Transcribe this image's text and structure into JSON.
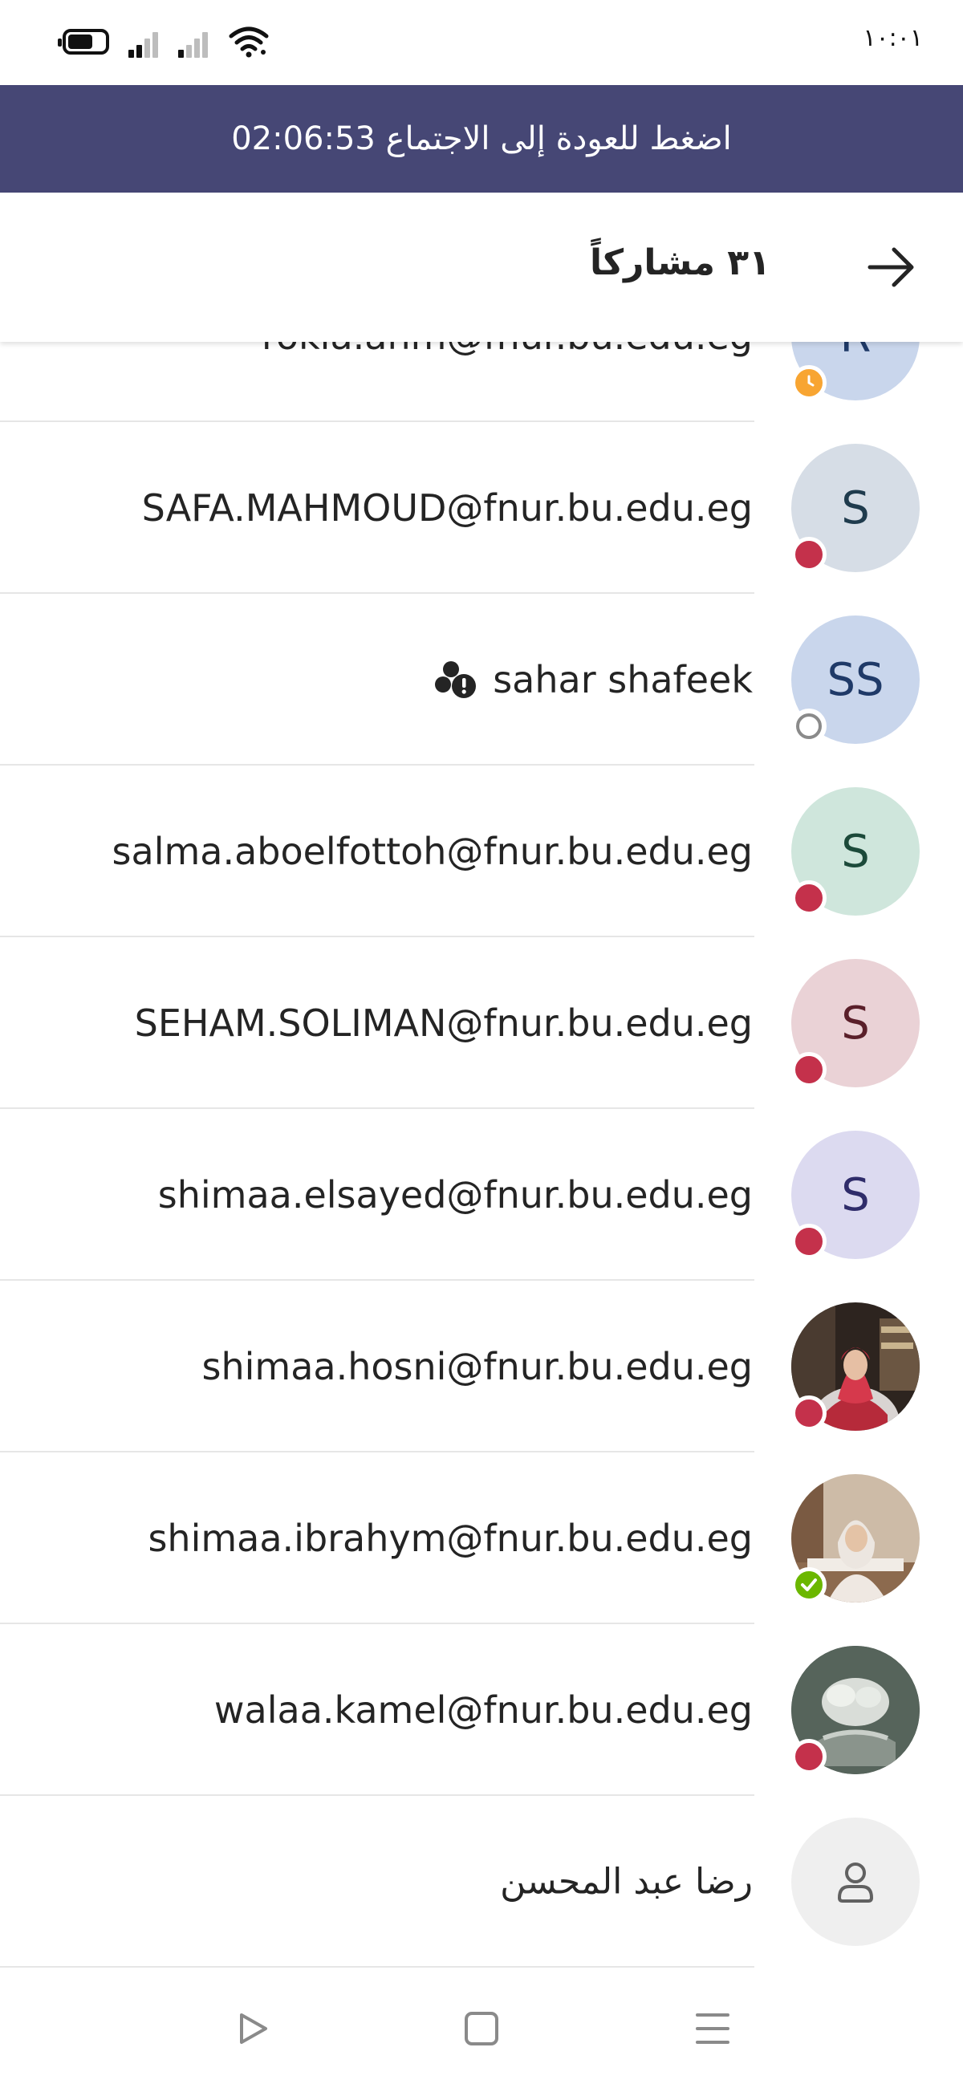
{
  "status_bar": {
    "time": "١٠:٠١"
  },
  "banner": {
    "text": "اضغط للعودة إلى الاجتماع 02:06:53"
  },
  "header": {
    "title": "٣١ مشاركاً"
  },
  "participants": [
    {
      "name": "rokia.ahm@fnur.bu.edu.eg",
      "initials": "R",
      "avatar_bg": "#c9d6ec",
      "avatar_fg": "#1f3a68",
      "presence": "away"
    },
    {
      "name": "SAFA.MAHMOUD@fnur.bu.edu.eg",
      "initials": "S",
      "avatar_bg": "#d6dde6",
      "avatar_fg": "#1f3b4d",
      "presence": "busy"
    },
    {
      "name": "sahar shafeek",
      "initials": "SS",
      "avatar_bg": "#c9d6ec",
      "avatar_fg": "#1f3a68",
      "presence": "offline",
      "tag_icon": "external-user-warning-icon"
    },
    {
      "name": "salma.aboelfottoh@fnur.bu.edu.eg",
      "initials": "S",
      "avatar_bg": "#cfe6dc",
      "avatar_fg": "#1c4a3a",
      "presence": "busy"
    },
    {
      "name": "SEHAM.SOLIMAN@fnur.bu.edu.eg",
      "initials": "S",
      "avatar_bg": "#ead2d6",
      "avatar_fg": "#5a1f2a",
      "presence": "busy"
    },
    {
      "name": "shimaa.elsayed@fnur.bu.edu.eg",
      "initials": "S",
      "avatar_bg": "#dcdaf0",
      "avatar_fg": "#2f2c6a",
      "presence": "busy"
    },
    {
      "name": "shimaa.hosni@fnur.bu.edu.eg",
      "initials": "",
      "avatar_bg": "#3a2a20",
      "avatar_fg": "#ffffff",
      "presence": "busy",
      "photo": "portrait-red-hijab"
    },
    {
      "name": "shimaa.ibrahym@fnur.bu.edu.eg",
      "initials": "",
      "avatar_bg": "#c8b8a6",
      "avatar_fg": "#ffffff",
      "presence": "available",
      "photo": "portrait-white-hijab"
    },
    {
      "name": "walaa.kamel@fnur.bu.edu.eg",
      "initials": "",
      "avatar_bg": "#4d5a52",
      "avatar_fg": "#ffffff",
      "presence": "busy",
      "photo": "hands-bouquet"
    },
    {
      "name": "رضا عبد المحسن",
      "initials": "",
      "avatar_bg": "#efefef",
      "avatar_fg": "#616161",
      "presence": "none",
      "icon": "person-icon"
    }
  ],
  "presence_colors": {
    "busy": "#c4314b",
    "available": "#6bb700",
    "away": "#f8a532",
    "offline": "#8a8a8a"
  },
  "theme": {
    "banner_bg": "#464775"
  }
}
